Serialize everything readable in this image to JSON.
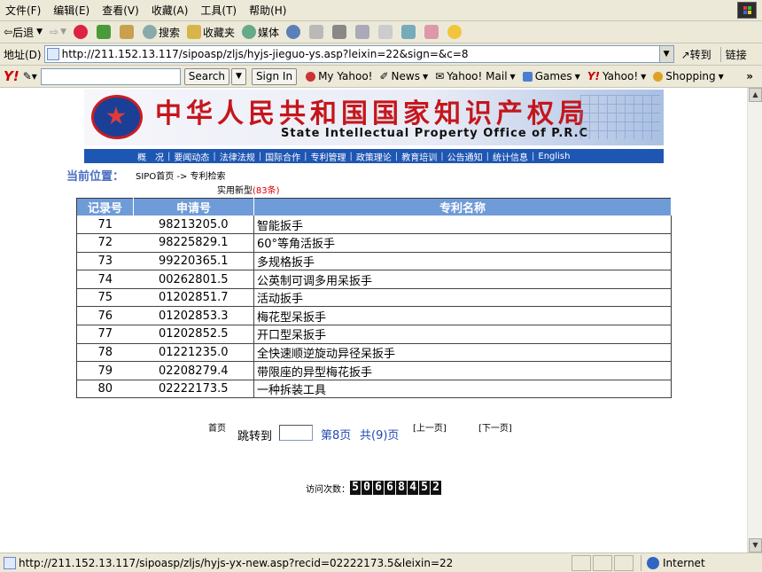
{
  "menubar": {
    "items": [
      "文件(F)",
      "编辑(E)",
      "查看(V)",
      "收藏(A)",
      "工具(T)",
      "帮助(H)"
    ]
  },
  "toolbar": {
    "back": "后退",
    "search": "搜索",
    "favorites": "收藏夹",
    "media": "媒体"
  },
  "address": {
    "label": "地址(D)",
    "url": "http://211.152.13.117/sipoasp/zljs/hyjs-jieguo-ys.asp?leixin=22&sign=&c=8",
    "go": "转到",
    "links": "链接"
  },
  "yahoo": {
    "search_btn": "Search",
    "sign_in": "Sign In",
    "items": [
      "My Yahoo!",
      "News",
      "Yahoo! Mail",
      "Games",
      "Yahoo!",
      "Shopping"
    ]
  },
  "banner": {
    "title_cn": "中华人民共和国国家知识产权局",
    "title_en": "State Intellectual Property Office of P.R.C"
  },
  "nav": [
    "概　况",
    "要闻动态",
    "法律法规",
    "国际合作",
    "专利管理",
    "政策理论",
    "教育培训",
    "公告通知",
    "统计信息",
    "English"
  ],
  "location": {
    "label": "当前位置：",
    "path": "SIPO首页 -> 专利检索",
    "category": "实用新型",
    "count": "(83条)"
  },
  "table": {
    "headers": [
      "记录号",
      "申请号",
      "专利名称"
    ],
    "rows": [
      [
        "71",
        "98213205.0",
        "智能扳手"
      ],
      [
        "72",
        "98225829.1",
        "60°等角活扳手"
      ],
      [
        "73",
        "99220365.1",
        "多规格扳手"
      ],
      [
        "74",
        "00262801.5",
        "公英制可调多用呆扳手"
      ],
      [
        "75",
        "01202851.7",
        "活动扳手"
      ],
      [
        "76",
        "01202853.3",
        "梅花型呆扳手"
      ],
      [
        "77",
        "01202852.5",
        "开口型呆扳手"
      ],
      [
        "78",
        "01221235.0",
        "全快速顺逆旋动异径呆扳手"
      ],
      [
        "79",
        "02208279.4",
        "带限座的异型梅花扳手"
      ],
      [
        "80",
        "02222173.5",
        "一种拆装工具"
      ]
    ]
  },
  "pager": {
    "first": "首页",
    "jump_to": "跳转到",
    "current": "第8页",
    "total": "共(9)页",
    "prev": "[上一页]",
    "next": "[下一页]"
  },
  "counter": {
    "label": "访问次数：",
    "value": "50668452"
  },
  "status": {
    "url": "http://211.152.13.117/sipoasp/zljs/hyjs-yx-new.asp?recid=02222173.5&leixin=22",
    "zone": "Internet"
  }
}
